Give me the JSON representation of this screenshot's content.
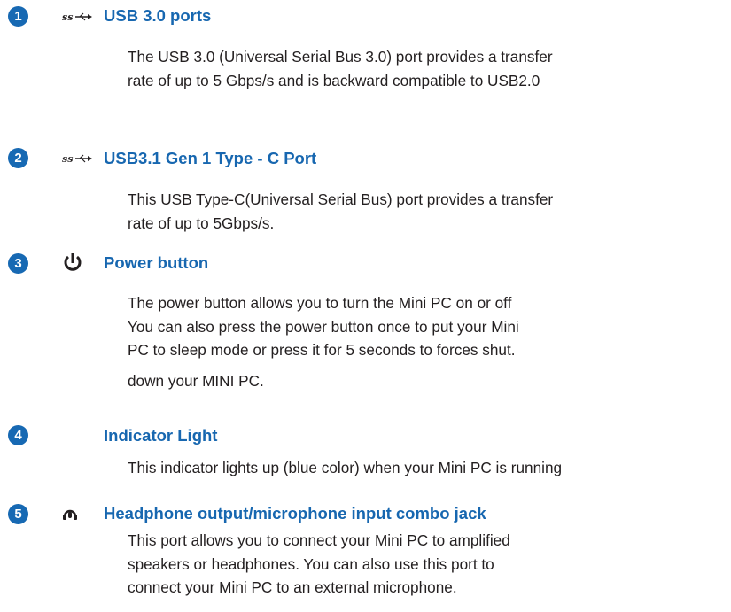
{
  "accent_color": "#1769b3",
  "items": [
    {
      "number": "1",
      "icon": "superspeed-usb-icon",
      "icon_text": "ss",
      "title": "USB 3.0 ports",
      "lines": [
        "The USB 3.0 (Universal Serial Bus 3.0) port provides a transfer",
        "rate of up to 5 Gbps/s and is backward compatible to USB2.0"
      ]
    },
    {
      "number": "2",
      "icon": "superspeed-usb-icon",
      "icon_text": "ss",
      "title": "USB3.1 Gen 1 Type - C Port",
      "lines": [
        "This USB Type-C(Universal Serial Bus) port provides a transfer",
        "rate of up to 5Gbps/s."
      ]
    },
    {
      "number": "3",
      "icon": "power-icon",
      "title": "Power button",
      "lines": [
        "The power button allows you to turn the Mini PC on or off",
        "You can also press the power button once to put your Mini",
        "PC to sleep mode or press it for 5 seconds to forces shut.",
        "down your MINI PC."
      ]
    },
    {
      "number": "4",
      "title": "Indicator Light",
      "lines": [
        "This indicator lights up (blue color) when your Mini PC is running"
      ]
    },
    {
      "number": "5",
      "icon": "headphone-mic-icon",
      "title": "Headphone output/microphone input combo jack",
      "lines": [
        "This port allows you to connect your Mini PC to amplified",
        "speakers or headphones. You can also use this port to",
        "connect your Mini PC to an external microphone."
      ]
    }
  ]
}
